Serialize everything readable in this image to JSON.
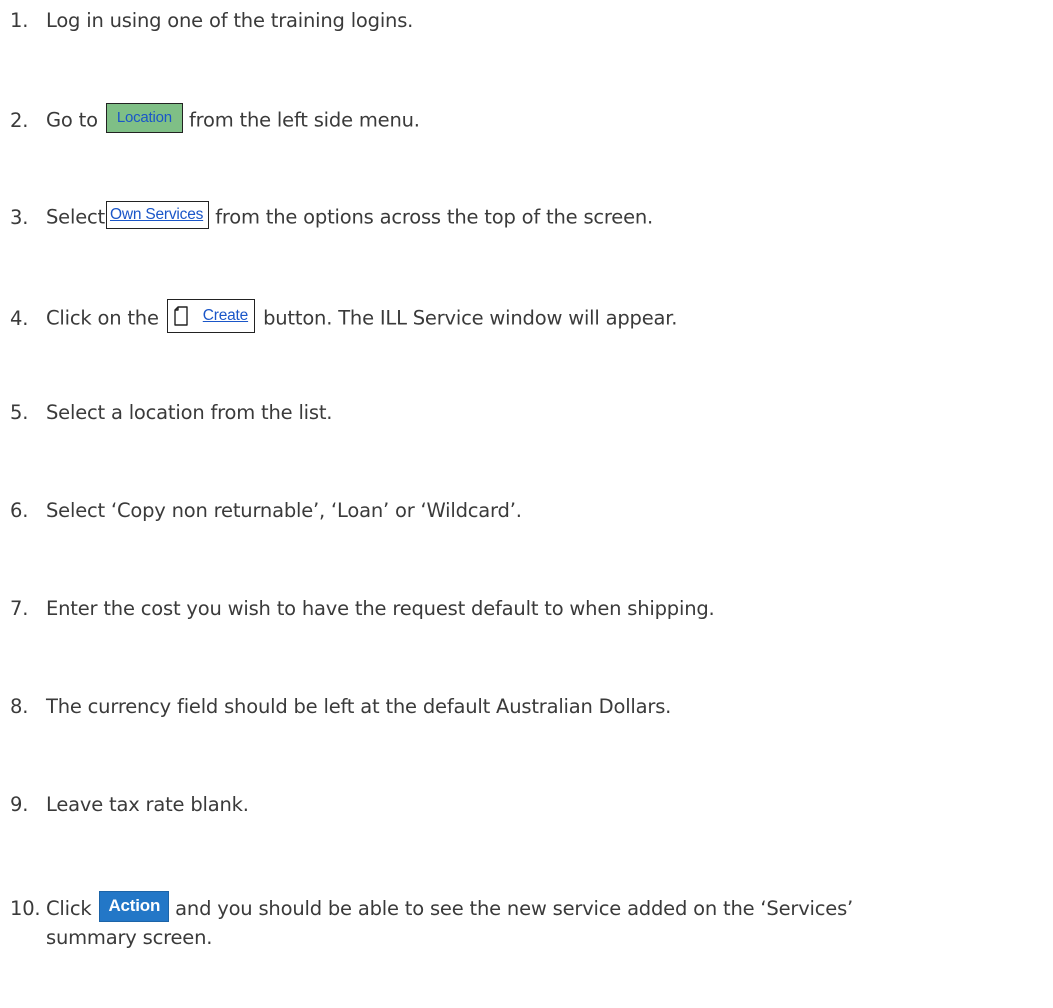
{
  "steps": [
    {
      "num": "1.",
      "text": "Log in using one of the training logins."
    },
    {
      "num": "2.",
      "before": "Go to",
      "button": "Location",
      "after": "from the left side menu."
    },
    {
      "num": "3.",
      "before": "Select",
      "button": "Own Services",
      "after": "from the options across the top of the screen."
    },
    {
      "num": "4.",
      "before": "Click on the",
      "button": "Create",
      "button_icon": "document-icon",
      "after": "button. The ILL Service window will appear."
    },
    {
      "num": "5.",
      "text": "Select a location from the list."
    },
    {
      "num": "6.",
      "text": "Select ‘Copy non returnable’, ‘Loan’ or ‘Wildcard’."
    },
    {
      "num": "7.",
      "text": "Enter the cost you wish to have the request default to when shipping."
    },
    {
      "num": "8.",
      "text": "The currency field should be left at the default Australian Dollars."
    },
    {
      "num": "9.",
      "text": "Leave tax rate blank."
    },
    {
      "num": "10.",
      "before": "Click",
      "button": "Action",
      "after": "and you should be able to see the new service added on the ‘Services’",
      "continuation": "summary screen."
    }
  ],
  "colors": {
    "text": "#3a3a3a",
    "link": "#1a56c8",
    "location_bg": "#7fbf86",
    "action_bg": "#2377c7"
  }
}
